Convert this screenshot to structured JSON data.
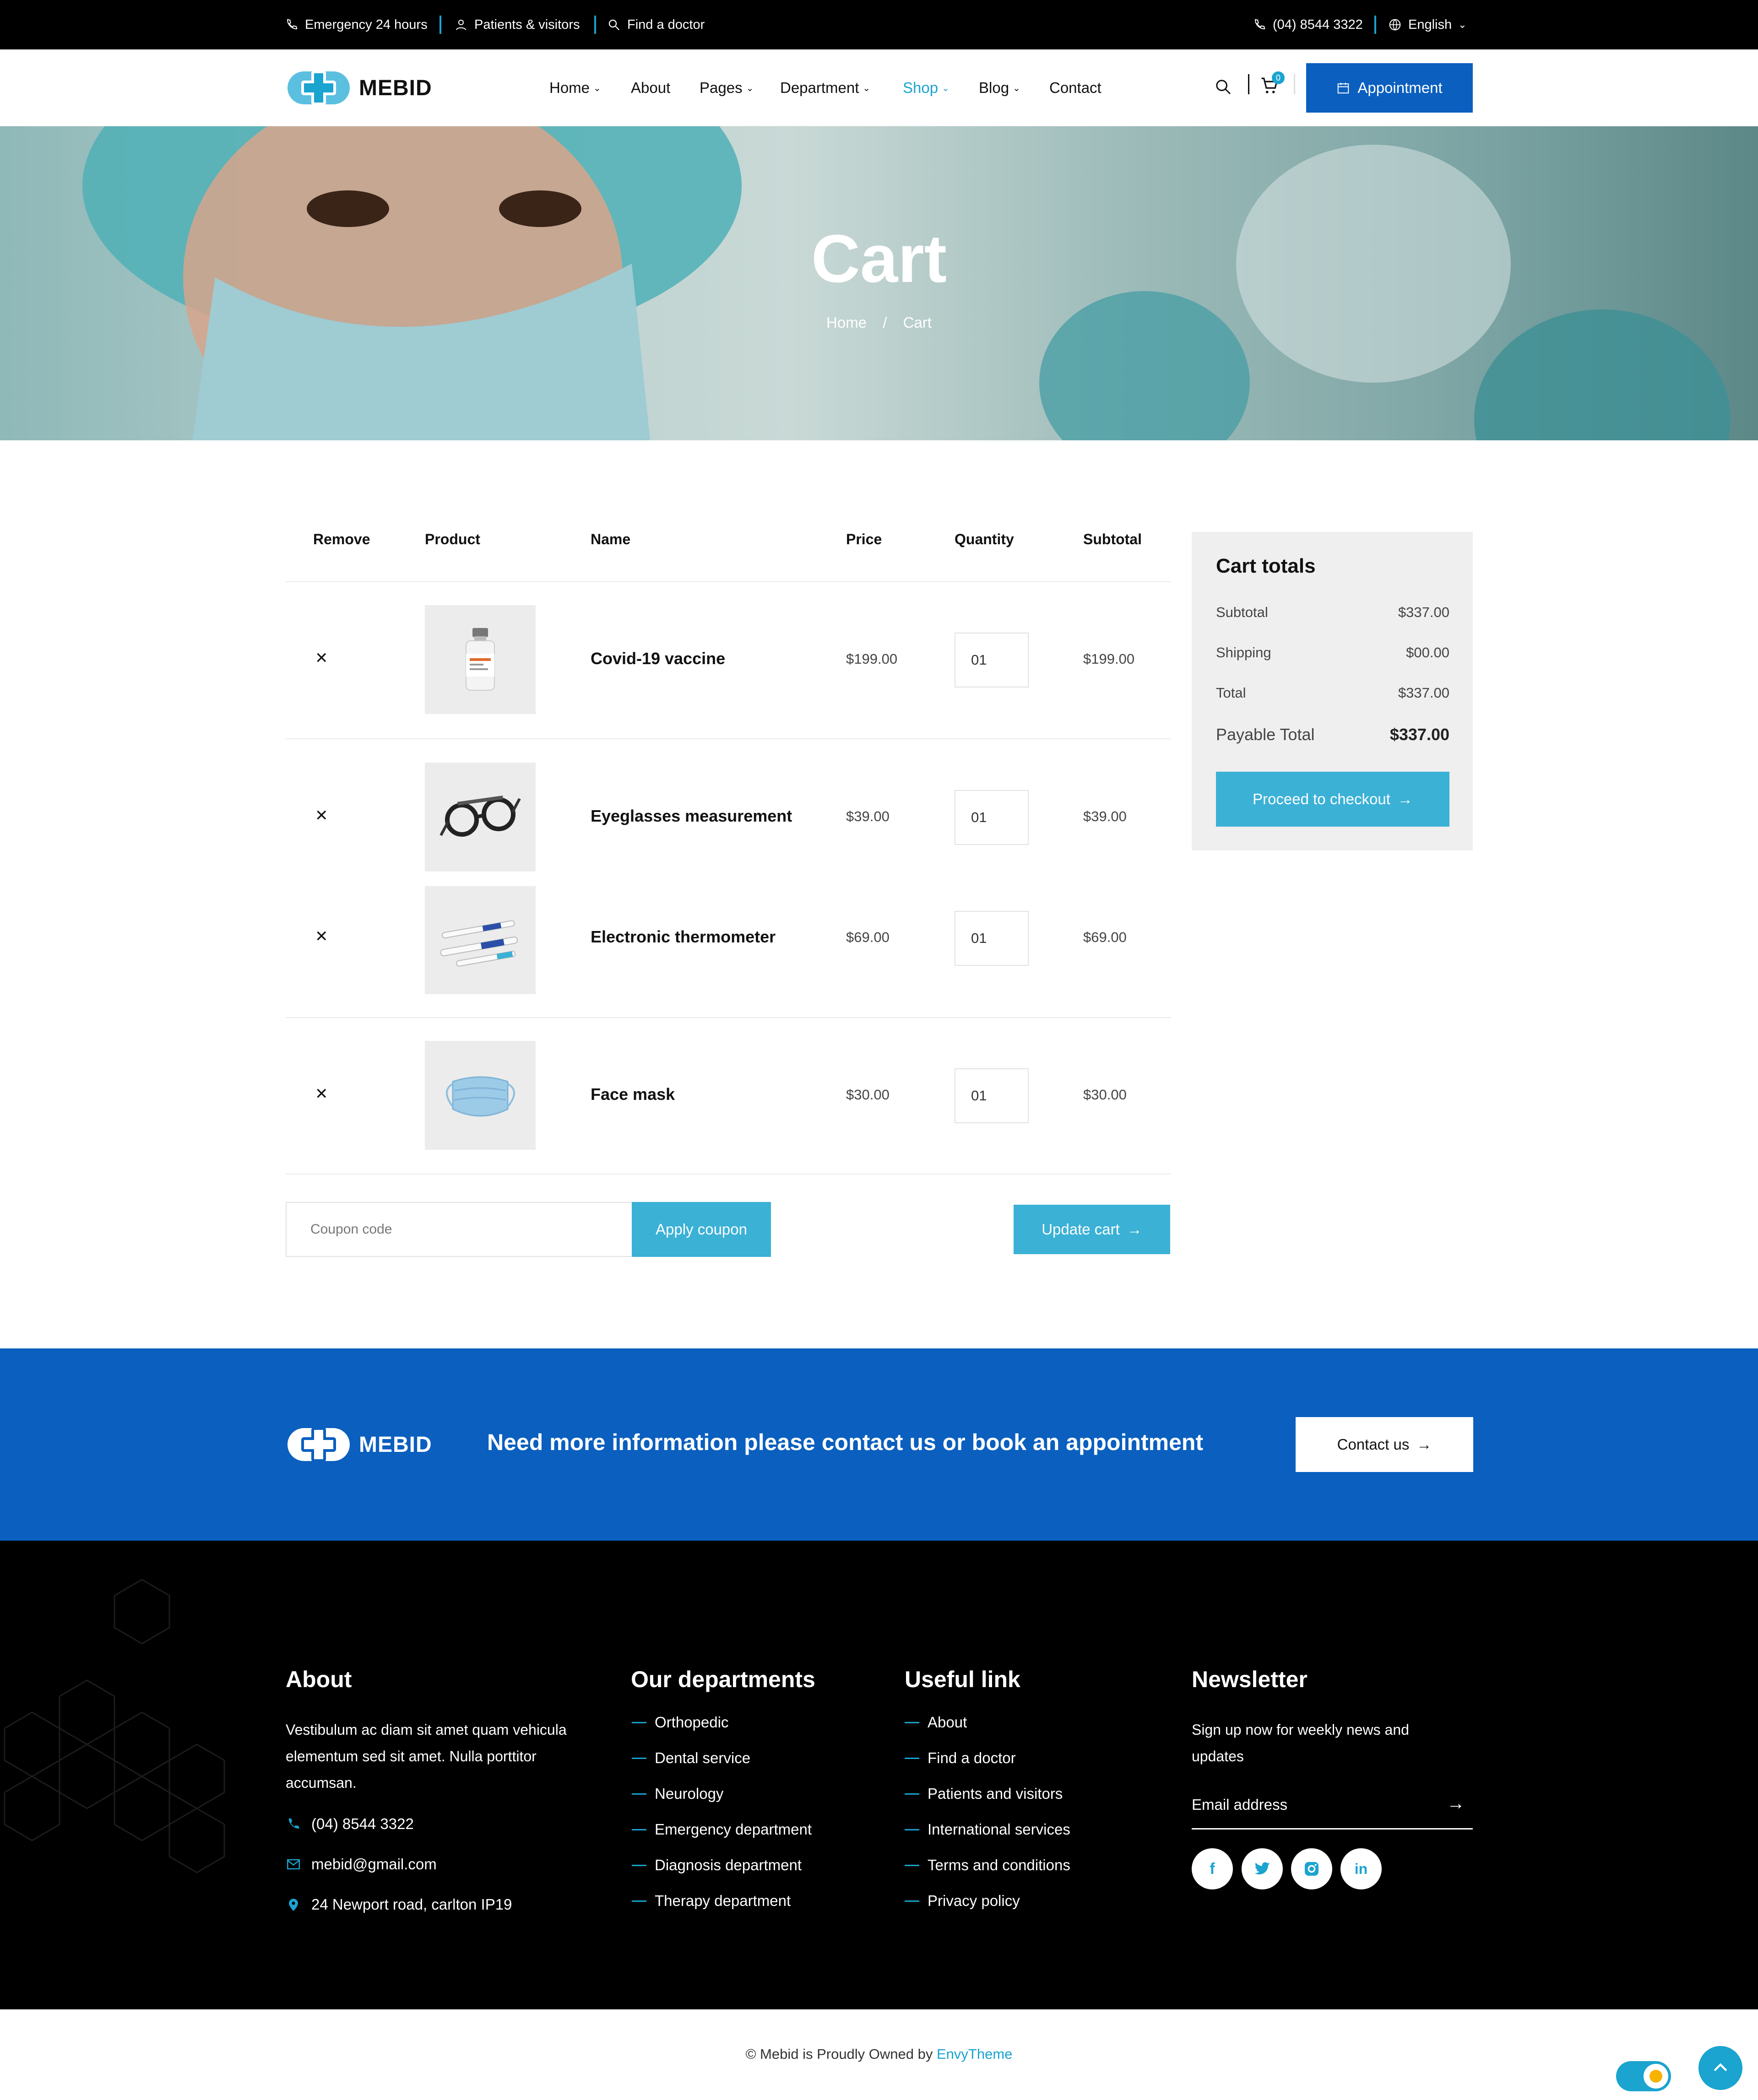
{
  "topbar": {
    "emergency": "Emergency 24 hours",
    "patients": "Patients & visitors",
    "find_doctor": "Find a doctor",
    "phone": "(04) 8544 3322",
    "language": "English"
  },
  "brand": {
    "name": "MEBID",
    "accent": "#1aa4cf",
    "primary": "#0a5fbf"
  },
  "nav": {
    "items": [
      {
        "label": "Home",
        "dropdown": true
      },
      {
        "label": "About",
        "dropdown": false
      },
      {
        "label": "Pages",
        "dropdown": true
      },
      {
        "label": "Department",
        "dropdown": true
      },
      {
        "label": "Shop",
        "dropdown": true,
        "active": true
      },
      {
        "label": "Blog",
        "dropdown": true
      },
      {
        "label": "Contact",
        "dropdown": false
      }
    ],
    "cart_count": "0",
    "appointment_label": "Appointment"
  },
  "hero": {
    "title": "Cart",
    "breadcrumb_home": "Home",
    "breadcrumb_sep": "/",
    "breadcrumb_current": "Cart"
  },
  "cart": {
    "headers": {
      "remove": "Remove",
      "product": "Product",
      "name": "Name",
      "price": "Price",
      "quantity": "Quantity",
      "subtotal": "Subtotal"
    },
    "remove_symbol": "✕",
    "rows": [
      {
        "name": "Covid-19 vaccine",
        "price": "$199.00",
        "qty": "01",
        "subtotal": "$199.00",
        "image": "vaccine-vial"
      },
      {
        "name": "Eyeglasses measurement",
        "price": "$39.00",
        "qty": "01",
        "subtotal": "$39.00",
        "image": "trial-frame"
      },
      {
        "name": "Electronic thermometer",
        "price": "$69.00",
        "qty": "01",
        "subtotal": "$69.00",
        "image": "thermometer"
      },
      {
        "name": "Face mask",
        "price": "$30.00",
        "qty": "01",
        "subtotal": "$30.00",
        "image": "face-mask"
      }
    ],
    "coupon_placeholder": "Coupon code",
    "apply_coupon": "Apply coupon",
    "update_cart": "Update cart"
  },
  "totals": {
    "title": "Cart totals",
    "subtotal_label": "Subtotal",
    "subtotal": "$337.00",
    "shipping_label": "Shipping",
    "shipping": "$00.00",
    "total_label": "Total",
    "total": "$337.00",
    "payable_label": "Payable Total",
    "payable": "$337.00",
    "checkout": "Proceed to checkout"
  },
  "cta": {
    "text": "Need more information please contact us or book an appointment",
    "button": "Contact us"
  },
  "footer": {
    "about_title": "About",
    "about_text": "Vestibulum ac diam sit amet quam vehicula elementum sed sit amet. Nulla porttitor accumsan.",
    "phone": "(04) 8544 3322",
    "email": "mebid@gmail.com",
    "address": "24 Newport road, carlton IP19",
    "departments_title": "Our departments",
    "departments": [
      "Orthopedic",
      "Dental service",
      "Neurology",
      "Emergency department",
      "Diagnosis department",
      "Therapy department"
    ],
    "useful_title": "Useful link",
    "useful": [
      "About",
      "Find a doctor",
      "Patients and visitors",
      "International services",
      "Terms and conditions",
      "Privacy policy"
    ],
    "newsletter_title": "Newsletter",
    "newsletter_text": "Sign up now for weekly news and updates",
    "email_placeholder": "Email address",
    "socials": [
      "facebook-icon",
      "twitter-icon",
      "instagram-icon",
      "linkedin-icon"
    ]
  },
  "copyright": {
    "text": "© Mebid is Proudly Owned by ",
    "brand": "EnvyTheme"
  }
}
